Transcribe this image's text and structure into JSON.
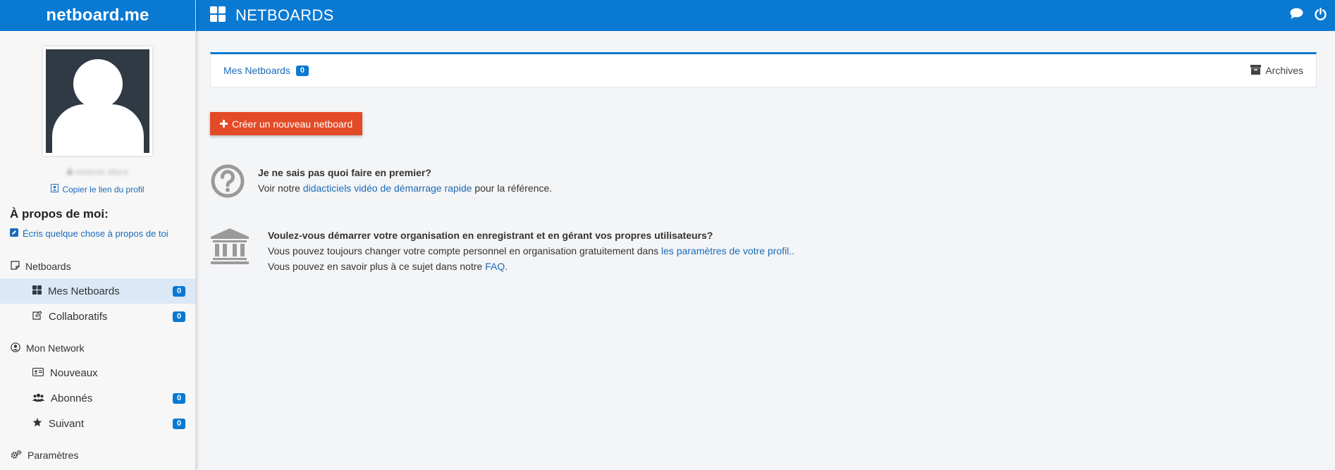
{
  "brand": {
    "name": "netboard.me"
  },
  "header": {
    "title": "NETBOARDS"
  },
  "profile": {
    "username": "melanie allard",
    "copy_link": "Copier le lien du profil",
    "about_title": "À propos de moi:",
    "about_write": "Écris quelque chose à propos de toi"
  },
  "sidebar": {
    "netboards_section": "Netboards",
    "mes_netboards": {
      "label": "Mes Netboards",
      "count": "0"
    },
    "collaboratifs": {
      "label": "Collaboratifs",
      "count": "0"
    },
    "network_section": "Mon Network",
    "nouveaux": {
      "label": "Nouveaux"
    },
    "abonnes": {
      "label": "Abonnés",
      "count": "0"
    },
    "suivant": {
      "label": "Suivant",
      "count": "0"
    },
    "parametres": "Paramètres"
  },
  "tabs": {
    "mes_netboards": {
      "label": "Mes Netboards",
      "count": "0"
    },
    "archives": "Archives"
  },
  "create_button": "Créer un nouveau netboard",
  "help": {
    "question": "Je ne sais pas quoi faire en premier?",
    "prefix": "Voir notre ",
    "link": "didacticiels vidéo de démarrage rapide",
    "suffix": " pour la référence."
  },
  "org": {
    "question": "Voulez-vous démarrer votre organisation en enregistrant et en gérant vos propres utilisateurs?",
    "line1_prefix": "Vous pouvez toujours changer votre compte personnel en organisation gratuitement dans ",
    "line1_link": "les paramètres de votre profil..",
    "line2_prefix": "Vous pouvez en savoir plus à ce sujet dans notre ",
    "line2_link": "FAQ",
    "line2_suffix": "."
  },
  "colors": {
    "primary": "#0a79d2",
    "accent": "#e34a26",
    "link": "#1a6bb8"
  }
}
